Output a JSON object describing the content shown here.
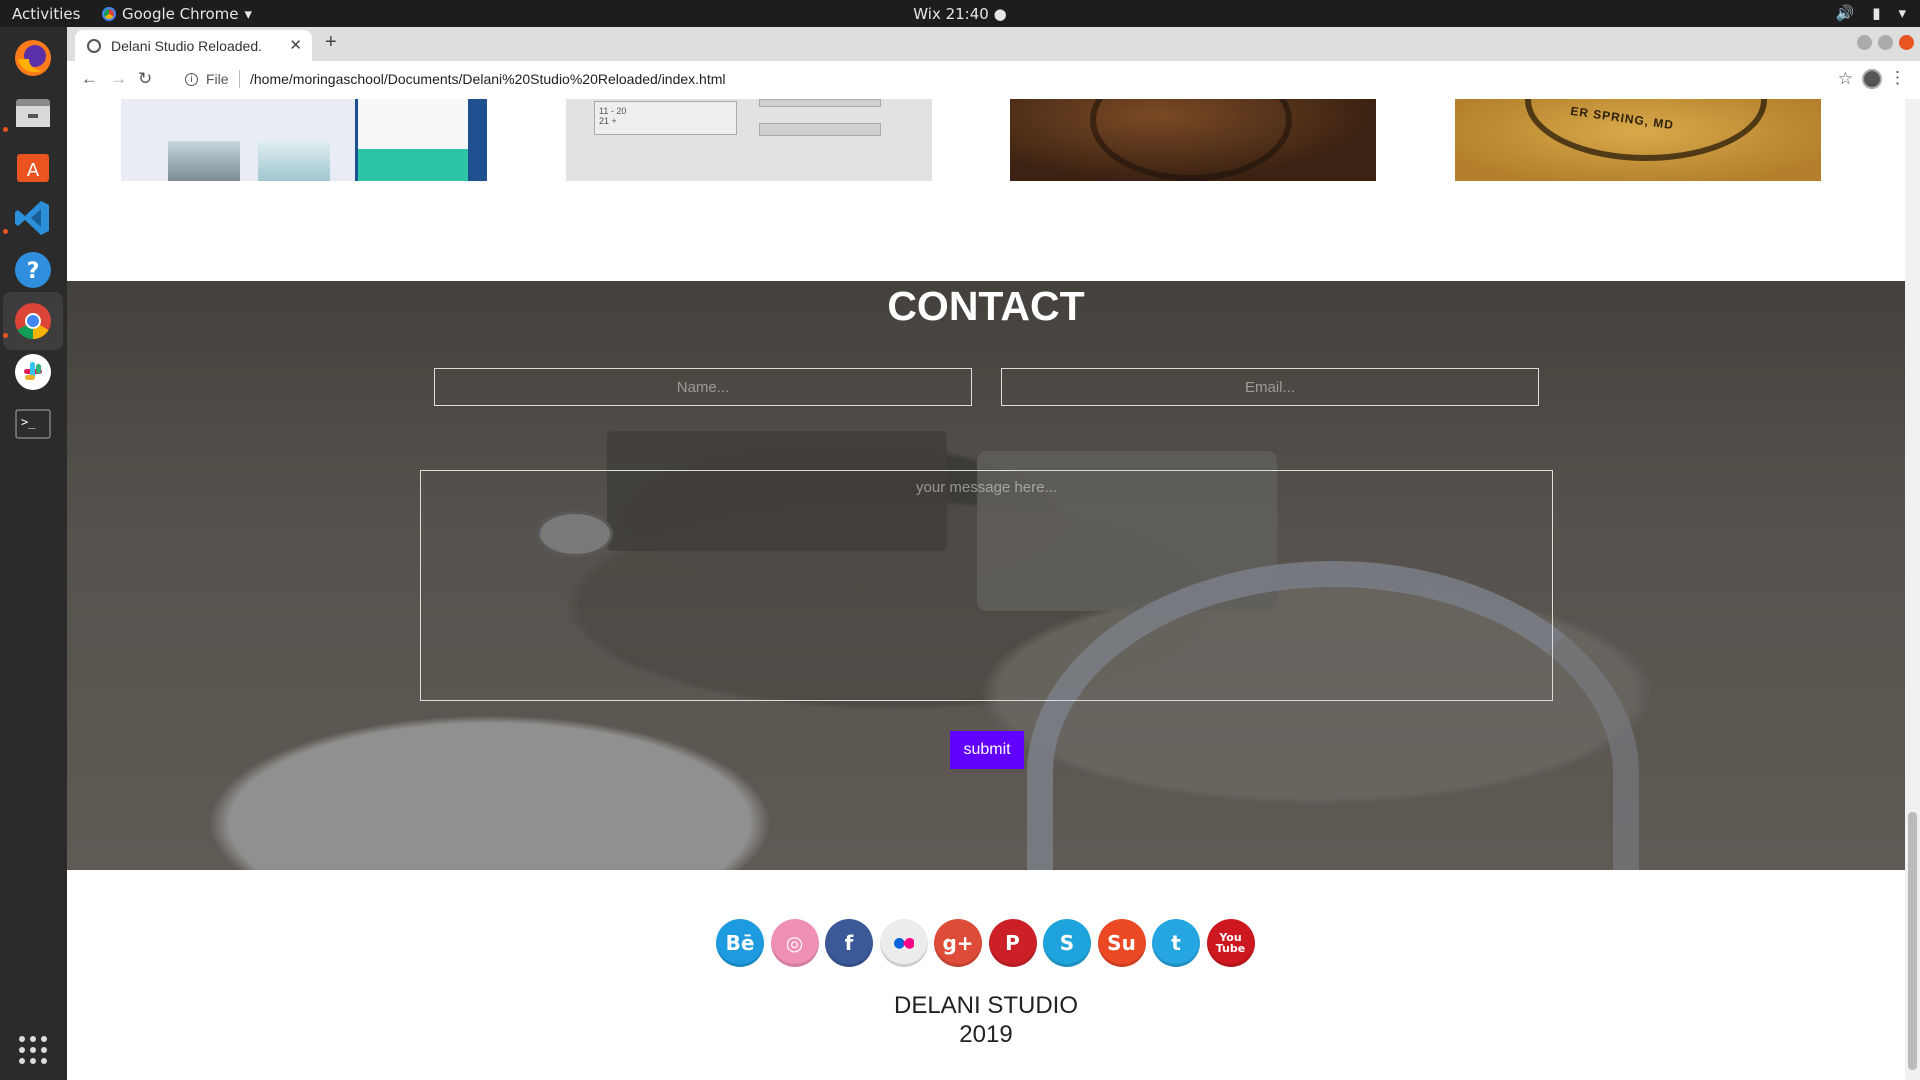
{
  "system": {
    "activities": "Activities",
    "app_name": "Google Chrome",
    "clock": "Wix 21:40"
  },
  "browser": {
    "tab_title": "Delani Studio Reloaded.",
    "file_label": "File",
    "url": "/home/moringaschool/Documents/Delani%20Studio%20Reloaded/index.html"
  },
  "portfolio": {
    "pf2_rows": [
      "11 - 20",
      "21 +"
    ],
    "pf4_text": "ER SPRING, MD"
  },
  "contact": {
    "heading": "CONTACT",
    "name_placeholder": "Name...",
    "email_placeholder": "Email...",
    "message_placeholder": "your message here...",
    "submit_label": "submit"
  },
  "social": [
    {
      "name": "behance",
      "glyph": "Bē",
      "color": "#1e9be0"
    },
    {
      "name": "dribbble",
      "glyph": "◎",
      "color": "#ef8fb5"
    },
    {
      "name": "facebook",
      "glyph": "f",
      "color": "#3b5998"
    },
    {
      "name": "flickr",
      "glyph": "●●",
      "color": "#ececec"
    },
    {
      "name": "google-plus",
      "glyph": "g+",
      "color": "#dd4b39"
    },
    {
      "name": "pinterest",
      "glyph": "P",
      "color": "#cb2027"
    },
    {
      "name": "skype",
      "glyph": "S",
      "color": "#1fa3dc"
    },
    {
      "name": "stumbleupon",
      "glyph": "Su",
      "color": "#eb4924"
    },
    {
      "name": "twitter",
      "glyph": "t",
      "color": "#26a6e0"
    },
    {
      "name": "youtube",
      "glyph": "You Tube",
      "color": "#cc181e"
    }
  ],
  "footer": {
    "studio": "DELANI STUDIO",
    "year": "2019"
  }
}
